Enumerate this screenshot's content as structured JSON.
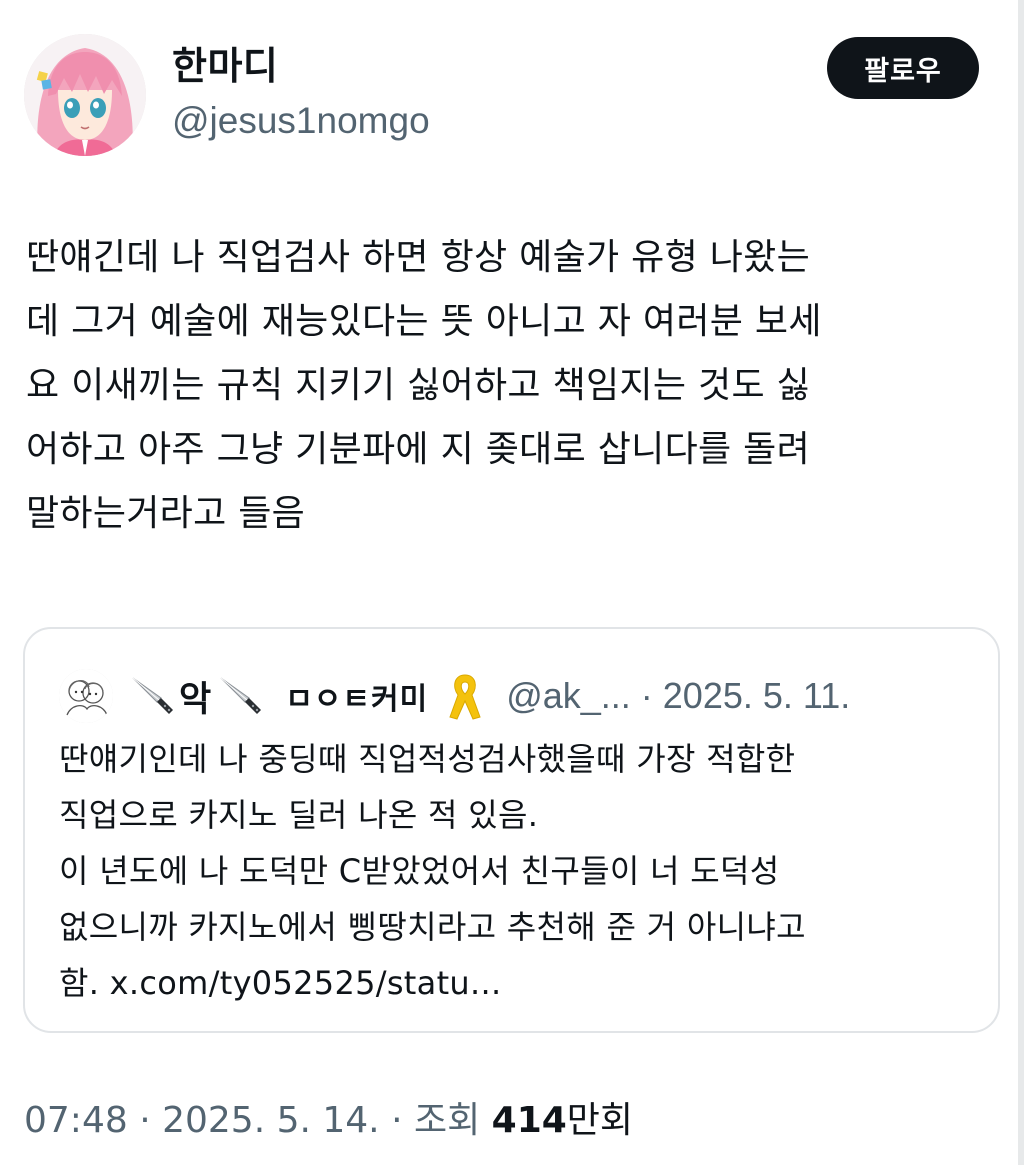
{
  "author": {
    "display_name": "한마디",
    "handle": "@jesus1nomgo"
  },
  "follow_label": "팔로우",
  "tweet": {
    "lines": [
      "딴얘긴데 나 직업검사 하면 항상 예술가 유형 나왔는",
      "데 그거 예술에 재능있다는 뜻 아니고 자 여러분 보세",
      "요 이새끼는 규칙 지키기 싫어하고 책임지는 것도 싫",
      "어하고 아주 그냥 기분파에 지 좆대로 삽니다를 돌려",
      "말하는거라고 들음"
    ]
  },
  "quote": {
    "name_part1": "악",
    "name_part2": "ㅁㅇㅌ커미",
    "meta": "@ak_... · 2025. 5. 11.",
    "lines": [
      "딴얘기인데 나 중딩때 직업적성검사했을때 가장 적합한",
      "직업으로 카지노 딜러 나온 적 있음.",
      "이 년도에 나 도덕만 C받았었어서 친구들이 너 도덕성",
      "없으니까 카지노에서 삥땅치라고 추천해 준 거 아니냐고",
      "함. x.com/ty052525/statu..."
    ],
    "icons": [
      "knife-icon",
      "knife-icon",
      "yellow-ribbon-icon"
    ]
  },
  "footer": {
    "time_date": "07:48 · 2025. 5. 14. · 조회 ",
    "views_count": "414",
    "views_unit": "만회"
  },
  "colors": {
    "text": "#0f1419",
    "secondary": "#536471",
    "border": "#e1e4e7",
    "button": "#0f1419",
    "ribbon": "#f4c20d"
  }
}
